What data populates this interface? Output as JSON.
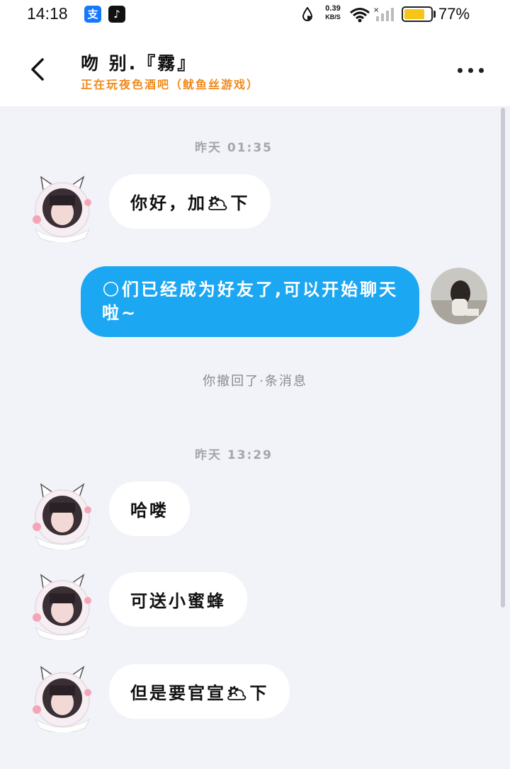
{
  "status_bar": {
    "time": "14:18",
    "apps": [
      {
        "name": "alipay-icon",
        "glyph": "支",
        "color": "#1677ff"
      },
      {
        "name": "tiktok-icon",
        "glyph": "♪",
        "color": "#111111"
      }
    ],
    "net_speed_value": "0.39",
    "net_speed_unit": "KB/S",
    "battery_percent": "77%",
    "battery_level": 0.77,
    "battery_color": "#f5c518"
  },
  "header": {
    "title": "吻 别.『霧』",
    "subtitle": "正在玩夜色酒吧（鱿鱼丝游戏）",
    "subtitle_color": "#f08a1c"
  },
  "chat": {
    "accent_blue": "#1ca7f2",
    "messages": [
      {
        "type": "timestamp",
        "text": "昨天 01:35"
      },
      {
        "type": "incoming",
        "text": "你好，加🌥下"
      },
      {
        "type": "outgoing",
        "text": "🌕们已经成为好友了,可以开始聊天啦~"
      },
      {
        "type": "system",
        "text": "你撤回了·条消息"
      },
      {
        "type": "timestamp",
        "text": "昨天 13:29"
      },
      {
        "type": "incoming",
        "text": "哈喽"
      },
      {
        "type": "incoming",
        "text": "可送小蜜蜂"
      },
      {
        "type": "incoming",
        "text": "但是要官宣🌥下"
      }
    ]
  }
}
